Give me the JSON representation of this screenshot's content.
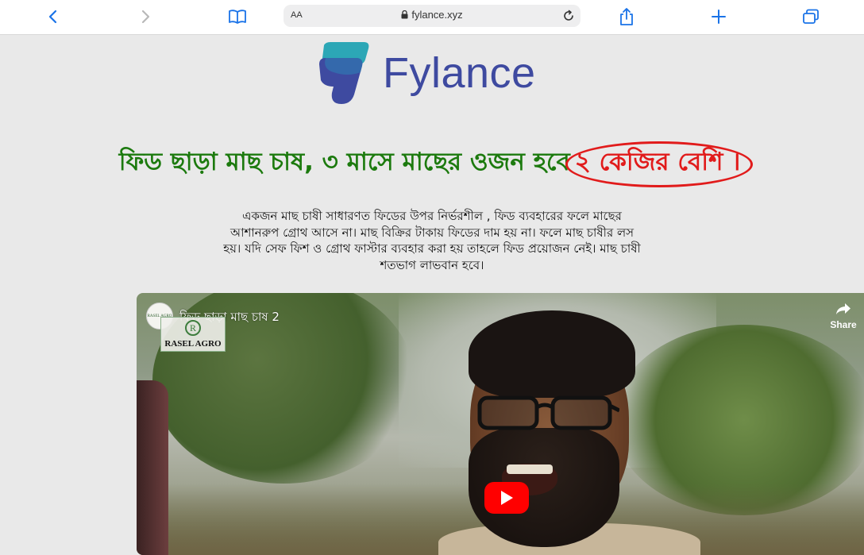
{
  "browser": {
    "url": "fylance.xyz",
    "aa_label": "AA"
  },
  "logo": {
    "text": "Fylance",
    "colors": {
      "primary": "#3e4aa0",
      "teal": "#2ca7b6"
    }
  },
  "headline": {
    "main": "ফিড ছাড়া মাছ চাষ, ৩ মাসে মাছের ওজন হবে",
    "highlight": "২ কেজির বেশি ।",
    "colors": {
      "green": "#1c7a0e",
      "red": "#e11b1b"
    }
  },
  "description": {
    "lines": [
      "একজন মাছ চাষী সাধারণত ফিডের উপর নির্ভরশীল , ফিড ব্যবহারের ফলে মাছের",
      "আশানরুপ গ্রোথ আসে না। মাছ বিক্রির টাকায় ফিডের দাম হয় না। ফলে মাছ চাষীর লস",
      "হয়। যদি সেফ ফিশ ও গ্রোথ ফাস্টার ব্যবহার করা হয় তাহলে ফিড প্রয়োজন নেই। মাছ চাষী",
      "শতভাগ লাভবান হবে।"
    ]
  },
  "video": {
    "title": "ফিড ছাড়া মাছ চাষ 2",
    "channel_avatar_text": "RASEL AGRO",
    "brand_emblem": "R",
    "brand_text": "RASEL AGRO",
    "share_label": "Share"
  }
}
